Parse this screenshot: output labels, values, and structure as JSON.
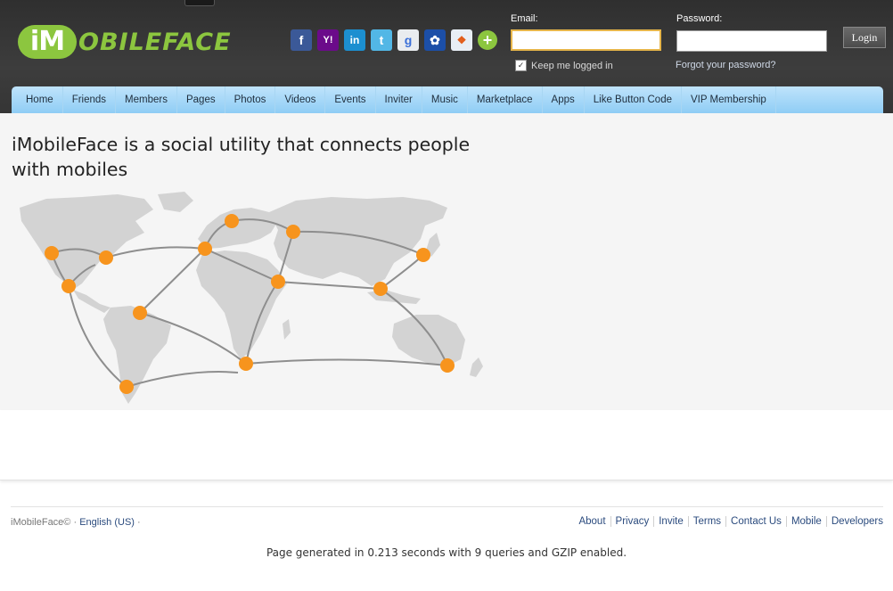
{
  "header": {
    "logo": {
      "mark": "iM",
      "text": "OBILEFACE"
    },
    "social_icons": [
      {
        "name": "facebook-icon",
        "glyph": "f"
      },
      {
        "name": "yahoo-icon",
        "glyph": "Y!"
      },
      {
        "name": "linkedin-icon",
        "glyph": "in"
      },
      {
        "name": "twitter-icon",
        "glyph": "t"
      },
      {
        "name": "google-icon",
        "glyph": "g"
      },
      {
        "name": "msn-icon",
        "glyph": "✿"
      },
      {
        "name": "windows-live-icon",
        "glyph": "❖"
      },
      {
        "name": "add-more-icon",
        "glyph": "+"
      }
    ],
    "login": {
      "email_label": "Email:",
      "email_value": "",
      "password_label": "Password:",
      "password_value": "",
      "keep_logged_in_label": "Keep me logged in",
      "keep_logged_in_checked": true,
      "forgot_password": "Forgot your password?",
      "login_button": "Login"
    }
  },
  "nav": {
    "items": [
      "Home",
      "Friends",
      "Members",
      "Pages",
      "Photos",
      "Videos",
      "Events",
      "Inviter",
      "Music",
      "Marketplace",
      "Apps",
      "Like Button Code",
      "VIP Membership"
    ]
  },
  "main": {
    "tagline": "iMobileFace is a social utility that connects people with mobiles",
    "map": {
      "land_color": "#d3d3d3",
      "marker_color": "#f7941d",
      "route_color": "#8e8e8e"
    }
  },
  "footer": {
    "copyright": "iMobileFace©",
    "separator": "·",
    "language": "English (US)",
    "links": [
      "About",
      "Privacy",
      "Invite",
      "Terms",
      "Contact Us",
      "Mobile",
      "Developers"
    ],
    "page_generated": "Page generated in 0.213 seconds with 9 queries and GZIP enabled."
  }
}
